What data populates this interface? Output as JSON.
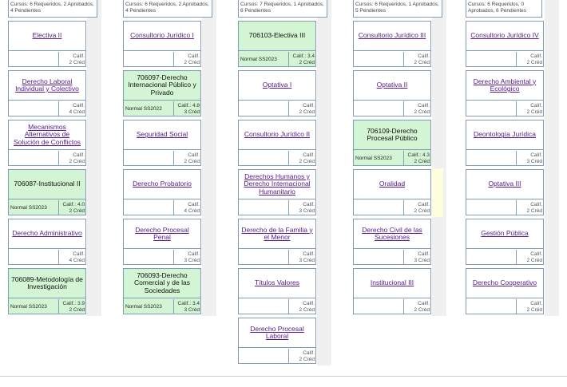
{
  "columns": [
    {
      "header": "Cursos: 6 Requeridos, 2 Aprobados, 4 Pendientes",
      "courses": [
        {
          "name": "Electiva II",
          "approved": false,
          "status": "",
          "grade": "Calif.",
          "credits": "2 Créd"
        },
        {
          "name": "Derecho Laboral Individual y Colectivo",
          "approved": false,
          "status": "",
          "grade": "Calif.",
          "credits": "4 Créd"
        },
        {
          "name": "Mecanismos Alternativos de Solución de Conflictos",
          "approved": false,
          "status": "",
          "grade": "Calif.",
          "credits": "2 Créd"
        },
        {
          "name": "706087-Institucional II",
          "approved": true,
          "status": "Normal SS2023",
          "grade": "Calif.: 4.0",
          "credits": "2 Créd"
        },
        {
          "name": "Derecho Administrativo",
          "approved": false,
          "status": "",
          "grade": "Calif.",
          "credits": "4 Créd"
        },
        {
          "name": "706089-Metodología de Investigación",
          "approved": true,
          "status": "Normal SS2023",
          "grade": "Calif.: 3.9",
          "credits": "2 Créd"
        }
      ]
    },
    {
      "header": "Cursos: 6 Requeridos, 2 Aprobados, 4 Pendientes",
      "courses": [
        {
          "name": "Consultorio Jurídico I",
          "approved": false,
          "status": "",
          "grade": "Calif.",
          "credits": "2 Créd"
        },
        {
          "name": "706097-Derecho Internacional Público y Privado",
          "approved": true,
          "status": "Normal SS2022",
          "grade": "Calif.: 4.8",
          "credits": "3 Créd"
        },
        {
          "name": "Seguridad Social",
          "approved": false,
          "status": "",
          "grade": "Calif.",
          "credits": "2 Créd"
        },
        {
          "name": "Derecho Probatorio",
          "approved": false,
          "status": "",
          "grade": "Calif.",
          "credits": "4 Créd"
        },
        {
          "name": "Derecho Procesal Penal",
          "approved": false,
          "status": "",
          "grade": "Calif.",
          "credits": "3 Créd"
        },
        {
          "name": "706093-Derecho Comercial y de las Sociedades",
          "approved": true,
          "status": "Normal SS2023",
          "grade": "Calif.: 3.4",
          "credits": "3 Créd"
        }
      ]
    },
    {
      "header": "Cursos: 7 Requeridos, 1 Aprobados, 6 Pendientes",
      "courses": [
        {
          "name": "706103-Electiva III",
          "approved": true,
          "status": "Normal SS2023",
          "grade": "Calif.: 3.4",
          "credits": "2 Créd"
        },
        {
          "name": "Optativa I",
          "approved": false,
          "status": "",
          "grade": "Calif.",
          "credits": "2 Créd"
        },
        {
          "name": "Consultorio Jurídico II",
          "approved": false,
          "status": "",
          "grade": "Calif.",
          "credits": "2 Créd"
        },
        {
          "name": "Derechos Humanos y Derecho Internacional Humanitario",
          "approved": false,
          "status": "",
          "grade": "Calif.",
          "credits": "3 Créd"
        },
        {
          "name": "Derecho de la Familia y el Menor",
          "approved": false,
          "status": "",
          "grade": "Calif.",
          "credits": "3 Créd"
        },
        {
          "name": "Títulos Valores",
          "approved": false,
          "status": "",
          "grade": "Calif.",
          "credits": "2 Créd"
        },
        {
          "name": "Derecho Procesal Laboral",
          "approved": false,
          "status": "",
          "grade": "Calif.",
          "credits": "2 Créd"
        }
      ]
    },
    {
      "header": "Cursos: 6 Requeridos, 1 Aprobados, 5 Pendientes",
      "courses": [
        {
          "name": "Consultorio Jurídico III",
          "approved": false,
          "status": "",
          "grade": "Calif.",
          "credits": "2 Créd"
        },
        {
          "name": "Optativa II",
          "approved": false,
          "status": "",
          "grade": "Calif.",
          "credits": "2 Créd"
        },
        {
          "name": "706109-Derecho Procesal Público",
          "approved": true,
          "status": "Normal SS2023",
          "grade": "Calif.: 4.3",
          "credits": "2 Créd"
        },
        {
          "name": "Oralidad",
          "approved": false,
          "status": "",
          "grade": "Calif.",
          "credits": "2 Créd"
        },
        {
          "name": "Derecho Civil de las Sucesiones",
          "approved": false,
          "status": "",
          "grade": "Calif.",
          "credits": "3 Créd"
        },
        {
          "name": "Institucional III",
          "approved": false,
          "status": "",
          "grade": "Calif.",
          "credits": "2 Créd"
        }
      ]
    },
    {
      "header": "Cursos: 6 Requeridos, 0 Aprobados, 6 Pendientes",
      "courses": [
        {
          "name": "Consultorio Jurídico IV",
          "approved": false,
          "status": "",
          "grade": "Calif.",
          "credits": "2 Créd"
        },
        {
          "name": "Derecho Ambiental y Ecológico",
          "approved": false,
          "status": "",
          "grade": "Calif.",
          "credits": "2 Créd"
        },
        {
          "name": "Deontología Jurídica",
          "approved": false,
          "status": "",
          "grade": "Calif.",
          "credits": "3 Créd"
        },
        {
          "name": "Optativa III",
          "approved": false,
          "status": "",
          "grade": "Calif.",
          "credits": "2 Créd"
        },
        {
          "name": "Gestión Pública",
          "approved": false,
          "status": "",
          "grade": "Calif.",
          "credits": "2 Créd"
        },
        {
          "name": "Derecho Cooperativo",
          "approved": false,
          "status": "",
          "grade": "Calif.",
          "credits": "2 Créd"
        }
      ]
    }
  ],
  "colors": {
    "approved_bg": "#d4f5d4",
    "link": "#551a8b",
    "border": "#7f9db9",
    "highlight": "#ffffdd"
  }
}
